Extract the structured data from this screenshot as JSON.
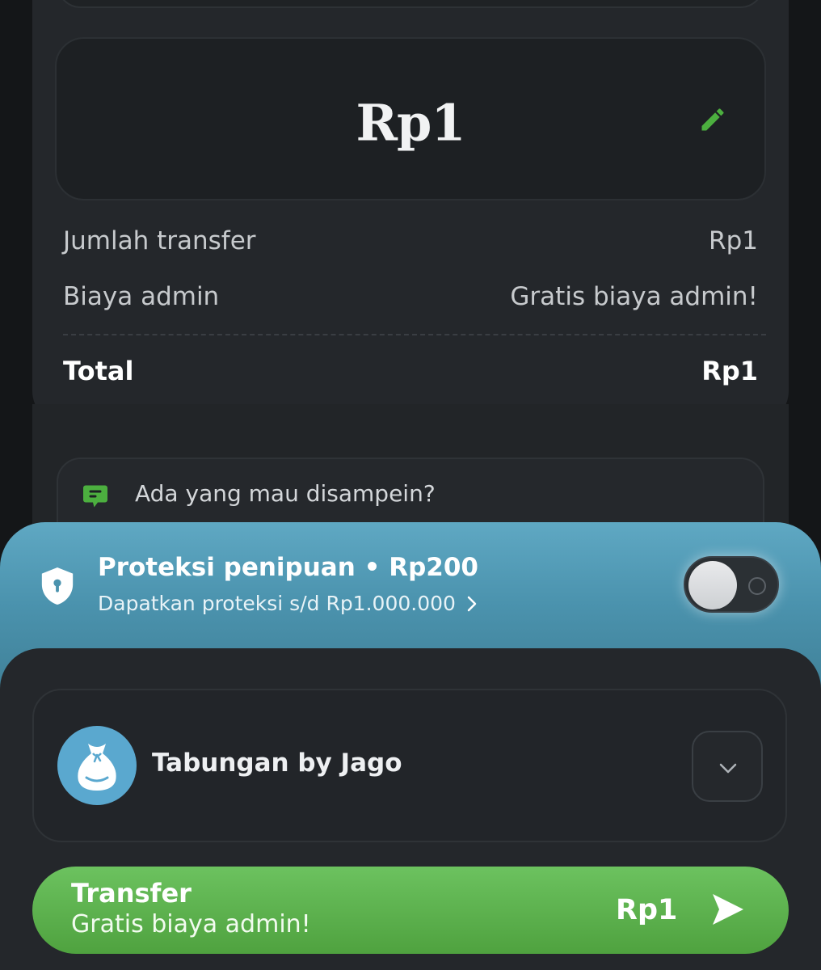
{
  "amount": {
    "value": "Rp1"
  },
  "breakdown": {
    "transfer_label": "Jumlah transfer",
    "transfer_value": "Rp1",
    "admin_label": "Biaya admin",
    "admin_value": "Gratis biaya admin!",
    "total_label": "Total",
    "total_value": "Rp1"
  },
  "note": {
    "placeholder": "Ada yang mau disampein?"
  },
  "protection": {
    "title": "Proteksi penipuan • Rp200",
    "subtitle": "Dapatkan proteksi s/d Rp1.000.000",
    "enabled": false
  },
  "account": {
    "name": "Tabungan by Jago"
  },
  "transfer_button": {
    "title": "Transfer",
    "subtitle": "Gratis biaya admin!",
    "amount": "Rp1"
  },
  "colors": {
    "accent_green": "#4fa23f",
    "banner_blue": "#4b93ae",
    "avatar_blue": "#5aa8cf"
  },
  "icons": [
    "edit-pencil-icon",
    "chat-note-icon",
    "shield-lock-icon",
    "chevron-right-icon",
    "money-bag-icon",
    "chevron-down-icon",
    "send-arrow-icon"
  ]
}
